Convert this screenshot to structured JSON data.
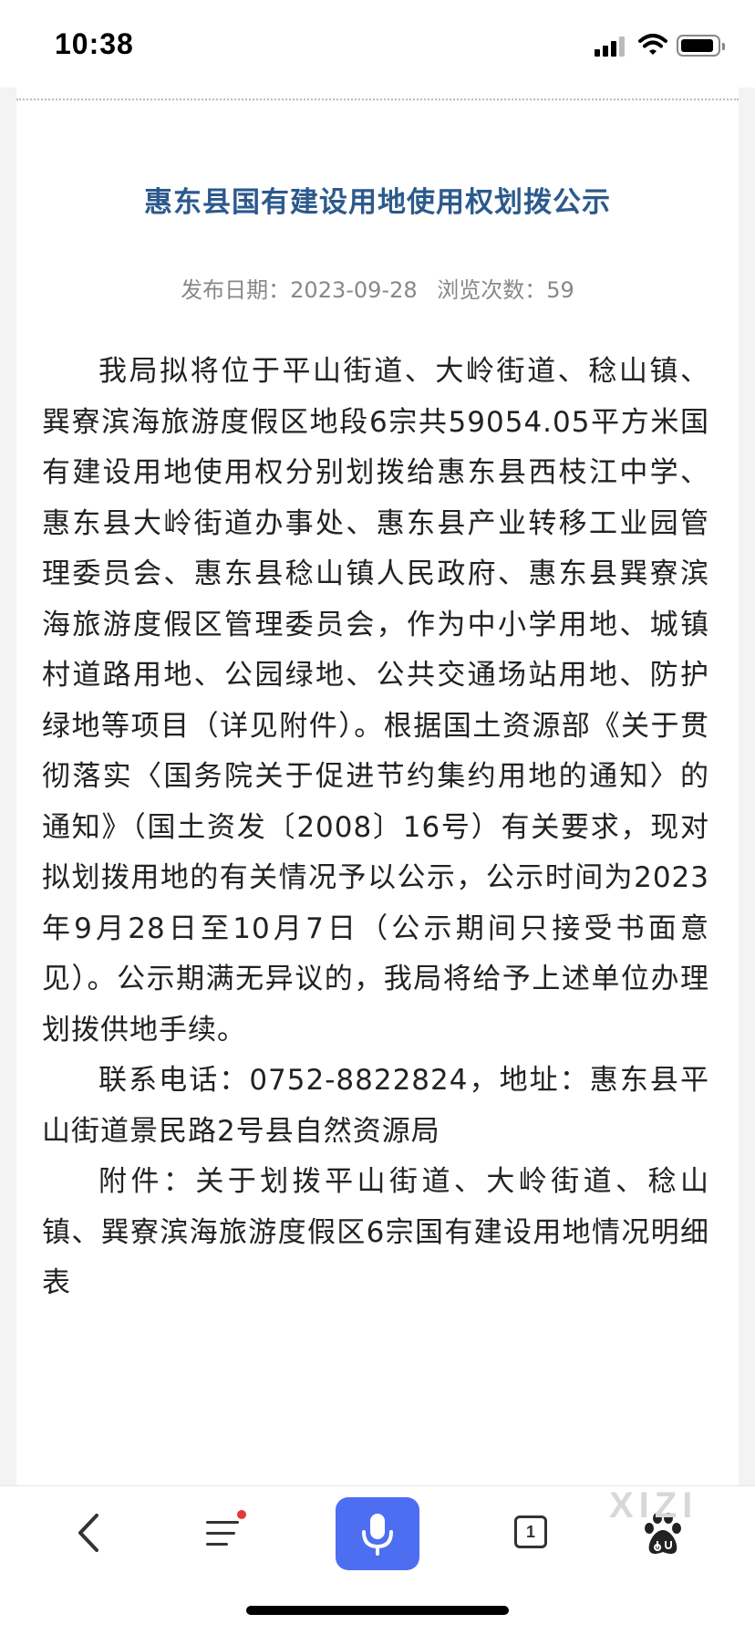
{
  "status_bar": {
    "time": "10:38"
  },
  "article": {
    "title": "惠东县国有建设用地使用权划拨公示",
    "publish_label": "发布日期：",
    "publish_date": "2023-09-28",
    "views_label": "浏览次数：",
    "views_count": "59",
    "paragraphs": [
      "我局拟将位于平山街道、大岭街道、稔山镇、巽寮滨海旅游度假区地段6宗共59054.05平方米国有建设用地使用权分别划拨给惠东县西枝江中学、惠东县大岭街道办事处、惠东县产业转移工业园管理委员会、惠东县稔山镇人民政府、惠东县巽寮滨海旅游度假区管理委员会，作为中小学用地、城镇村道路用地、公园绿地、公共交通场站用地、防护绿地等项目（详见附件）。根据国土资源部《关于贯彻落实〈国务院关于促进节约集约用地的通知〉的通知》（国土资发〔2008〕16号）有关要求，现对拟划拨用地的有关情况予以公示，公示时间为2023年9月28日至10月7日（公示期间只接受书面意见）。公示期满无异议的，我局将给予上述单位办理划拨供地手续。",
      "联系电话：0752-8822824，地址：惠东县平山街道景民路2号县自然资源局",
      "附件：关于划拨平山街道、大岭街道、稔山镇、巽寮滨海旅游度假区6宗国有建设用地情况明细表"
    ]
  },
  "toolbar": {
    "tab_count": "1",
    "watermark": "XIZI"
  },
  "colors": {
    "title": "#2c5a8c",
    "mic_button": "#4e6ef2",
    "notification_dot": "#e53935"
  },
  "icons": [
    "back-icon",
    "menu-icon",
    "mic-icon",
    "tabs-icon",
    "baidu-paw-icon",
    "signal-icon",
    "wifi-icon",
    "battery-icon"
  ]
}
